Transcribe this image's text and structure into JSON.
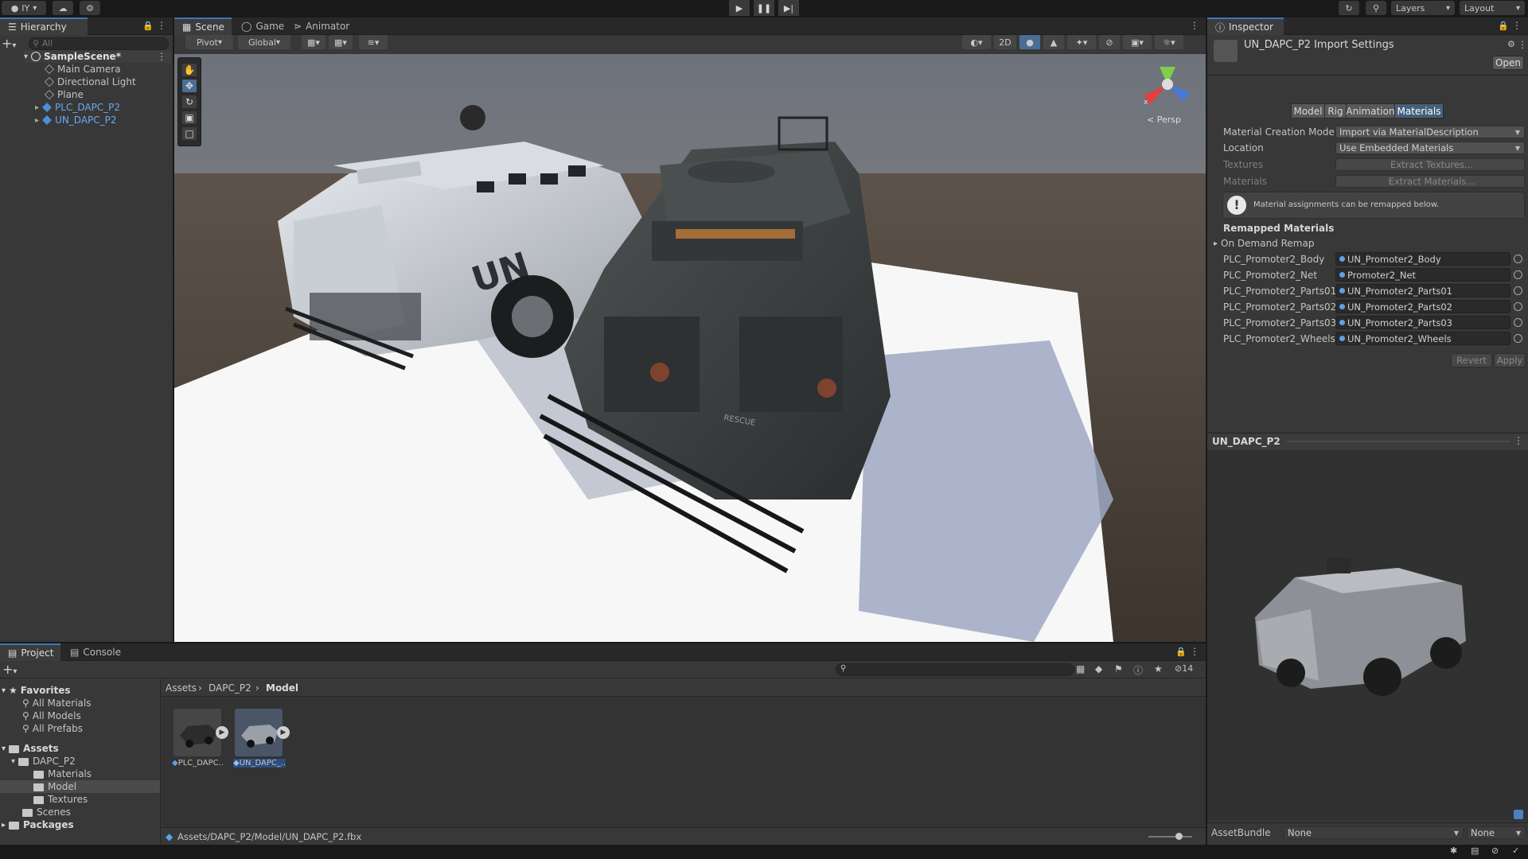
{
  "toolbar": {
    "account_label": "IY",
    "layers_label": "Layers",
    "layout_label": "Layout"
  },
  "hierarchy": {
    "tab_label": "Hierarchy",
    "search_placeholder": "All",
    "scene_name": "SampleScene*",
    "items": [
      {
        "label": "Main Camera",
        "kind": "gameobject"
      },
      {
        "label": "Directional Light",
        "kind": "gameobject"
      },
      {
        "label": "Plane",
        "kind": "gameobject"
      },
      {
        "label": "PLC_DAPC_P2",
        "kind": "prefab"
      },
      {
        "label": "UN_DAPC_P2",
        "kind": "prefab"
      }
    ]
  },
  "scene_view": {
    "tabs": [
      {
        "label": "Scene",
        "icon": "grid-icon"
      },
      {
        "label": "Game",
        "icon": "gamepad-icon"
      },
      {
        "label": "Animator",
        "icon": "animator-icon"
      }
    ],
    "pivot_label": "Pivot",
    "global_label": "Global",
    "mode_2d_label": "2D",
    "persp_label": "< Persp",
    "gizmo_x_label": "x",
    "vehicle_marking_left": "UN",
    "vehicle_marking_right": "RESCUE"
  },
  "inspector": {
    "tab_label": "Inspector",
    "title": "UN_DAPC_P2 Import Settings",
    "open_label": "Open",
    "subtabs": [
      "Model",
      "Rig",
      "Animation",
      "Materials"
    ],
    "active_subtab": "Materials",
    "material_creation_mode_label": "Material Creation Mode",
    "material_creation_mode_value": "Import via MaterialDescription",
    "location_label": "Location",
    "location_value": "Use Embedded Materials",
    "textures_label": "Textures",
    "extract_textures_label": "Extract Textures...",
    "materials_label": "Materials",
    "extract_materials_label": "Extract Materials...",
    "info_text": "Material assignments can be remapped below.",
    "remapped_header": "Remapped Materials",
    "on_demand_label": "On Demand Remap",
    "remaps": [
      {
        "source": "PLC_Promoter2_Body",
        "target": "UN_Promoter2_Body"
      },
      {
        "source": "PLC_Promoter2_Net",
        "target": "Promoter2_Net"
      },
      {
        "source": "PLC_Promoter2_Parts01",
        "target": "UN_Promoter2_Parts01"
      },
      {
        "source": "PLC_Promoter2_Parts02",
        "target": "UN_Promoter2_Parts02"
      },
      {
        "source": "PLC_Promoter2_Parts03",
        "target": "UN_Promoter2_Parts03"
      },
      {
        "source": "PLC_Promoter2_Wheels",
        "target": "UN_Promoter2_Wheels"
      }
    ],
    "revert_label": "Revert",
    "apply_label": "Apply",
    "preview_title": "UN_DAPC_P2",
    "assetbundle_label": "AssetBundle",
    "assetbundle_value": "None",
    "assetbundle_variant": "None"
  },
  "project": {
    "tabs": [
      "Project",
      "Console"
    ],
    "favorites_label": "Favorites",
    "favorites": [
      "All Materials",
      "All Models",
      "All Prefabs"
    ],
    "assets_label": "Assets",
    "tree": [
      {
        "label": "DAPC_P2",
        "depth": 1
      },
      {
        "label": "Materials",
        "depth": 2
      },
      {
        "label": "Model",
        "depth": 2
      },
      {
        "label": "Textures",
        "depth": 2
      },
      {
        "label": "Scenes",
        "depth": 1
      }
    ],
    "packages_label": "Packages",
    "breadcrumb": [
      "Assets",
      "DAPC_P2",
      "Model"
    ],
    "hidden_count": "14",
    "files": [
      {
        "label": "PLC_DAPC..."
      },
      {
        "label": "UN_DAPC_..."
      }
    ],
    "path_label": "Assets/DAPC_P2/Model/UN_DAPC_P2.fbx"
  }
}
